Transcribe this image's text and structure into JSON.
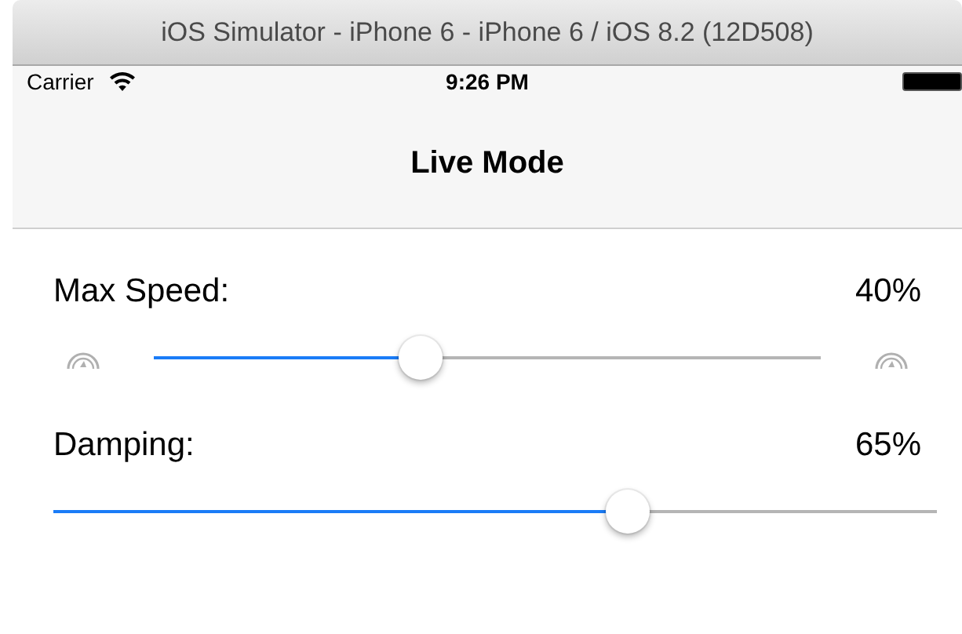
{
  "window": {
    "title": "iOS Simulator - iPhone 6 - iPhone 6 / iOS 8.2 (12D508)"
  },
  "status_bar": {
    "carrier": "Carrier",
    "time": "9:26 PM"
  },
  "nav_bar": {
    "title": "Live Mode"
  },
  "settings": [
    {
      "label": "Max Speed:",
      "reading": "40%",
      "level": 0.4,
      "kind": "icon-slider"
    },
    {
      "label": "Damping:",
      "reading": "65%",
      "level": 0.65,
      "kind": "plain-slider"
    }
  ]
}
